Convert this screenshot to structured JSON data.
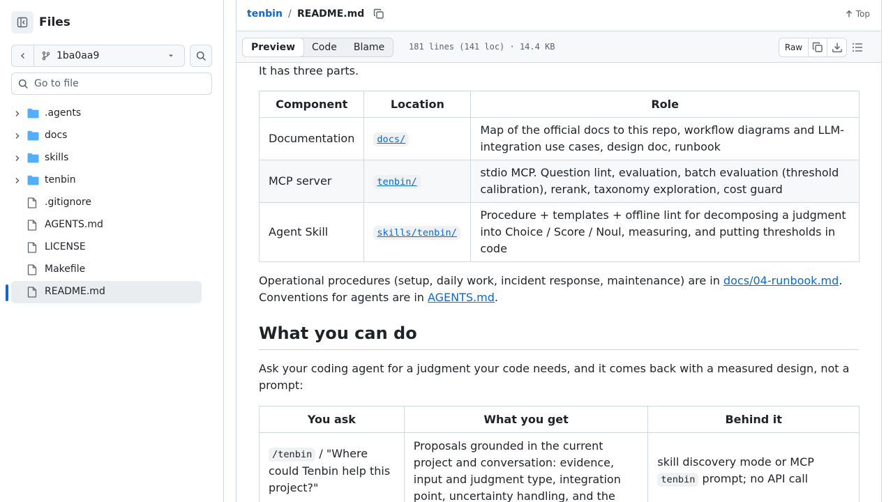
{
  "sidebar": {
    "title": "Files",
    "branch": "1ba0aa9",
    "goto_placeholder": "Go to file",
    "items": [
      {
        "label": ".agents",
        "type": "folder"
      },
      {
        "label": "docs",
        "type": "folder"
      },
      {
        "label": "skills",
        "type": "folder"
      },
      {
        "label": "tenbin",
        "type": "folder"
      },
      {
        "label": ".gitignore",
        "type": "file"
      },
      {
        "label": "AGENTS.md",
        "type": "file"
      },
      {
        "label": "LICENSE",
        "type": "file"
      },
      {
        "label": "Makefile",
        "type": "file"
      },
      {
        "label": "README.md",
        "type": "file",
        "active": true
      }
    ]
  },
  "header": {
    "repo": "tenbin",
    "separator": "/",
    "file": "README.md",
    "top_label": "Top"
  },
  "filebar": {
    "tabs": [
      "Preview",
      "Code",
      "Blame"
    ],
    "info": "181 lines (141 loc) · 14.4 KB",
    "raw_label": "Raw"
  },
  "content": {
    "intro": "It has three parts.",
    "table1": {
      "headers": [
        "Component",
        "Location",
        "Role"
      ],
      "rows": [
        {
          "component": "Documentation",
          "location": "docs/",
          "role": "Map of the official docs to this repo, workflow diagrams and LLM-integration use cases, design doc, runbook"
        },
        {
          "component": "MCP server",
          "location": "tenbin/",
          "role": "stdio MCP. Question lint, evaluation, batch evaluation (threshold calibration), rerank, taxonomy exploration, cost guard"
        },
        {
          "component": "Agent Skill",
          "location": "skills/tenbin/",
          "role": "Procedure + templates + offline lint for decomposing a judgment into Choice / Score / Noul, measuring, and putting thresholds in code"
        }
      ]
    },
    "ops": {
      "pre": "Operational procedures (setup, daily work, incident response, maintenance) are in ",
      "link1": "docs/04-runbook.md",
      "mid": ". Conventions for agents are in ",
      "link2": "AGENTS.md",
      "post": "."
    },
    "heading": "What you can do",
    "ask_para": "Ask your coding agent for a judgment your code needs, and it comes back with a measured design, not a prompt:",
    "table2": {
      "headers": [
        "You ask",
        "What you get",
        "Behind it"
      ],
      "row": {
        "ask_code": "/tenbin",
        "ask_text": " / \"Where could Tenbin help this project?\"",
        "get": "Proposals grounded in the current project and conversation: evidence, input and judgment type, integration point, uncertainty handling, and the",
        "behind_pre": "skill discovery mode or MCP ",
        "behind_code": "tenbin",
        "behind_post": " prompt; no API call"
      }
    }
  }
}
